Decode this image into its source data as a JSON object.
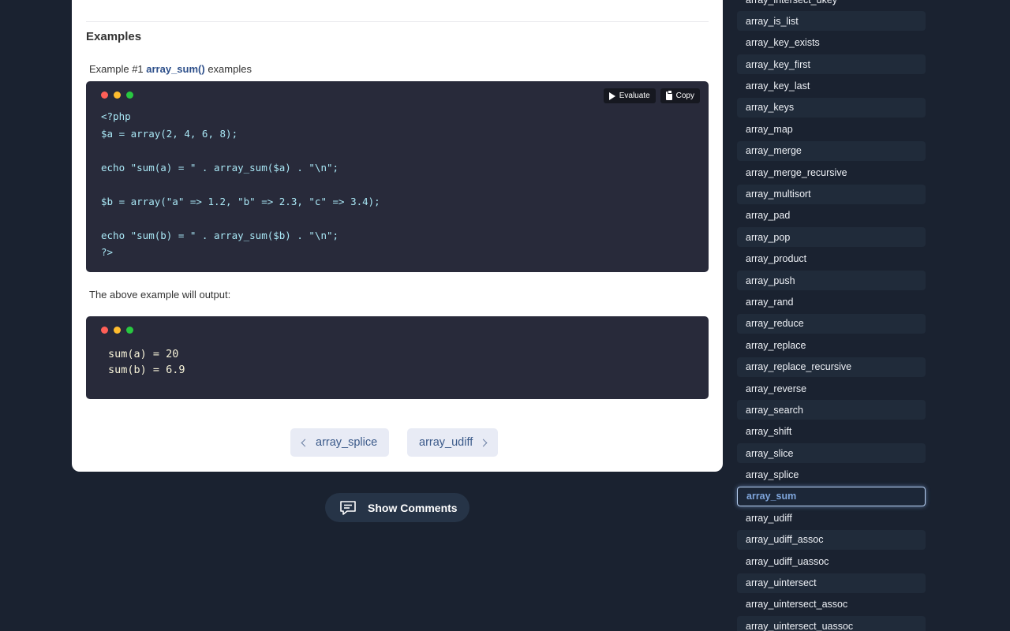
{
  "content": {
    "section_title": "Examples",
    "example_caption_prefix": "Example #1 ",
    "example_caption_fn": "array_sum()",
    "example_caption_suffix": " examples",
    "code_actions": {
      "evaluate_label": "Evaluate",
      "copy_label": "Copy"
    },
    "code_lines": [
      "<?php",
      "$a = array(2, 4, 6, 8);",
      "",
      "echo \"sum(a) = \" . array_sum($a) . \"\\n\";",
      "",
      "$b = array(\"a\" => 1.2, \"b\" => 2.3, \"c\" => 3.4);",
      "",
      "echo \"sum(b) = \" . array_sum($b) . \"\\n\";",
      "?>"
    ],
    "output_caption": "The above example will output:",
    "output_lines": [
      "sum(a) = 20",
      "sum(b) = 6.9"
    ],
    "pager": {
      "prev_label": "array_splice",
      "next_label": "array_udiff"
    }
  },
  "comments": {
    "label": "Show Comments"
  },
  "sidebar": {
    "items": [
      {
        "label": "array_intersect_ukey",
        "shaded": false,
        "active": false
      },
      {
        "label": "array_is_list",
        "shaded": true,
        "active": false
      },
      {
        "label": "array_key_exists",
        "shaded": false,
        "active": false
      },
      {
        "label": "array_key_first",
        "shaded": true,
        "active": false
      },
      {
        "label": "array_key_last",
        "shaded": false,
        "active": false
      },
      {
        "label": "array_keys",
        "shaded": true,
        "active": false
      },
      {
        "label": "array_map",
        "shaded": false,
        "active": false
      },
      {
        "label": "array_merge",
        "shaded": true,
        "active": false
      },
      {
        "label": "array_merge_recursive",
        "shaded": false,
        "active": false
      },
      {
        "label": "array_multisort",
        "shaded": true,
        "active": false
      },
      {
        "label": "array_pad",
        "shaded": false,
        "active": false
      },
      {
        "label": "array_pop",
        "shaded": true,
        "active": false
      },
      {
        "label": "array_product",
        "shaded": false,
        "active": false
      },
      {
        "label": "array_push",
        "shaded": true,
        "active": false
      },
      {
        "label": "array_rand",
        "shaded": false,
        "active": false
      },
      {
        "label": "array_reduce",
        "shaded": true,
        "active": false
      },
      {
        "label": "array_replace",
        "shaded": false,
        "active": false
      },
      {
        "label": "array_replace_recursive",
        "shaded": true,
        "active": false
      },
      {
        "label": "array_reverse",
        "shaded": false,
        "active": false
      },
      {
        "label": "array_search",
        "shaded": true,
        "active": false
      },
      {
        "label": "array_shift",
        "shaded": false,
        "active": false
      },
      {
        "label": "array_slice",
        "shaded": true,
        "active": false
      },
      {
        "label": "array_splice",
        "shaded": false,
        "active": false
      },
      {
        "label": "array_sum",
        "shaded": false,
        "active": true
      },
      {
        "label": "array_udiff",
        "shaded": false,
        "active": false
      },
      {
        "label": "array_udiff_assoc",
        "shaded": true,
        "active": false
      },
      {
        "label": "array_udiff_uassoc",
        "shaded": false,
        "active": false
      },
      {
        "label": "array_uintersect",
        "shaded": true,
        "active": false
      },
      {
        "label": "array_uintersect_assoc",
        "shaded": false,
        "active": false
      },
      {
        "label": "array_uintersect_uassoc",
        "shaded": true,
        "active": false
      }
    ]
  }
}
